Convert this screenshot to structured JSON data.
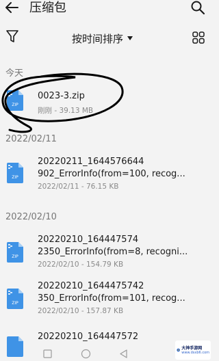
{
  "header": {
    "title": "压缩包"
  },
  "toolbar": {
    "sort_label": "按时间排序"
  },
  "sections": [
    {
      "label": "今天"
    },
    {
      "label": "2022/02/11"
    },
    {
      "label": "2022/02/10"
    }
  ],
  "files": [
    {
      "name_line1": "0023-3.zip",
      "name_line2": "",
      "meta": "刚刚 - 39.13 MB"
    },
    {
      "name_line1": "20220211_1644576644",
      "name_line2": "902_ErrorInfo(from=100, recog...",
      "meta": "2022/02/11 - 76.15 KB"
    },
    {
      "name_line1": "20220210_164447574",
      "name_line2": "2350_ErrorInfo(from=8, recogni...",
      "meta": "2022/02/10 - 154.79 KB"
    },
    {
      "name_line1": "20220210_1644475742",
      "name_line2": "350_ErrorInfo(from=101, recog...",
      "meta": "2022/02/10 - 157.87 KB"
    },
    {
      "name_line1": "20220210_164447572",
      "name_line2": "",
      "meta": ""
    }
  ],
  "icons": {
    "file_label": "ZIP"
  },
  "watermark": {
    "name": "大神手游网",
    "domain": "www.dsxb6.com"
  },
  "colors": {
    "zip_icon": "#3f93e6",
    "annotation_ink": "#000000"
  }
}
